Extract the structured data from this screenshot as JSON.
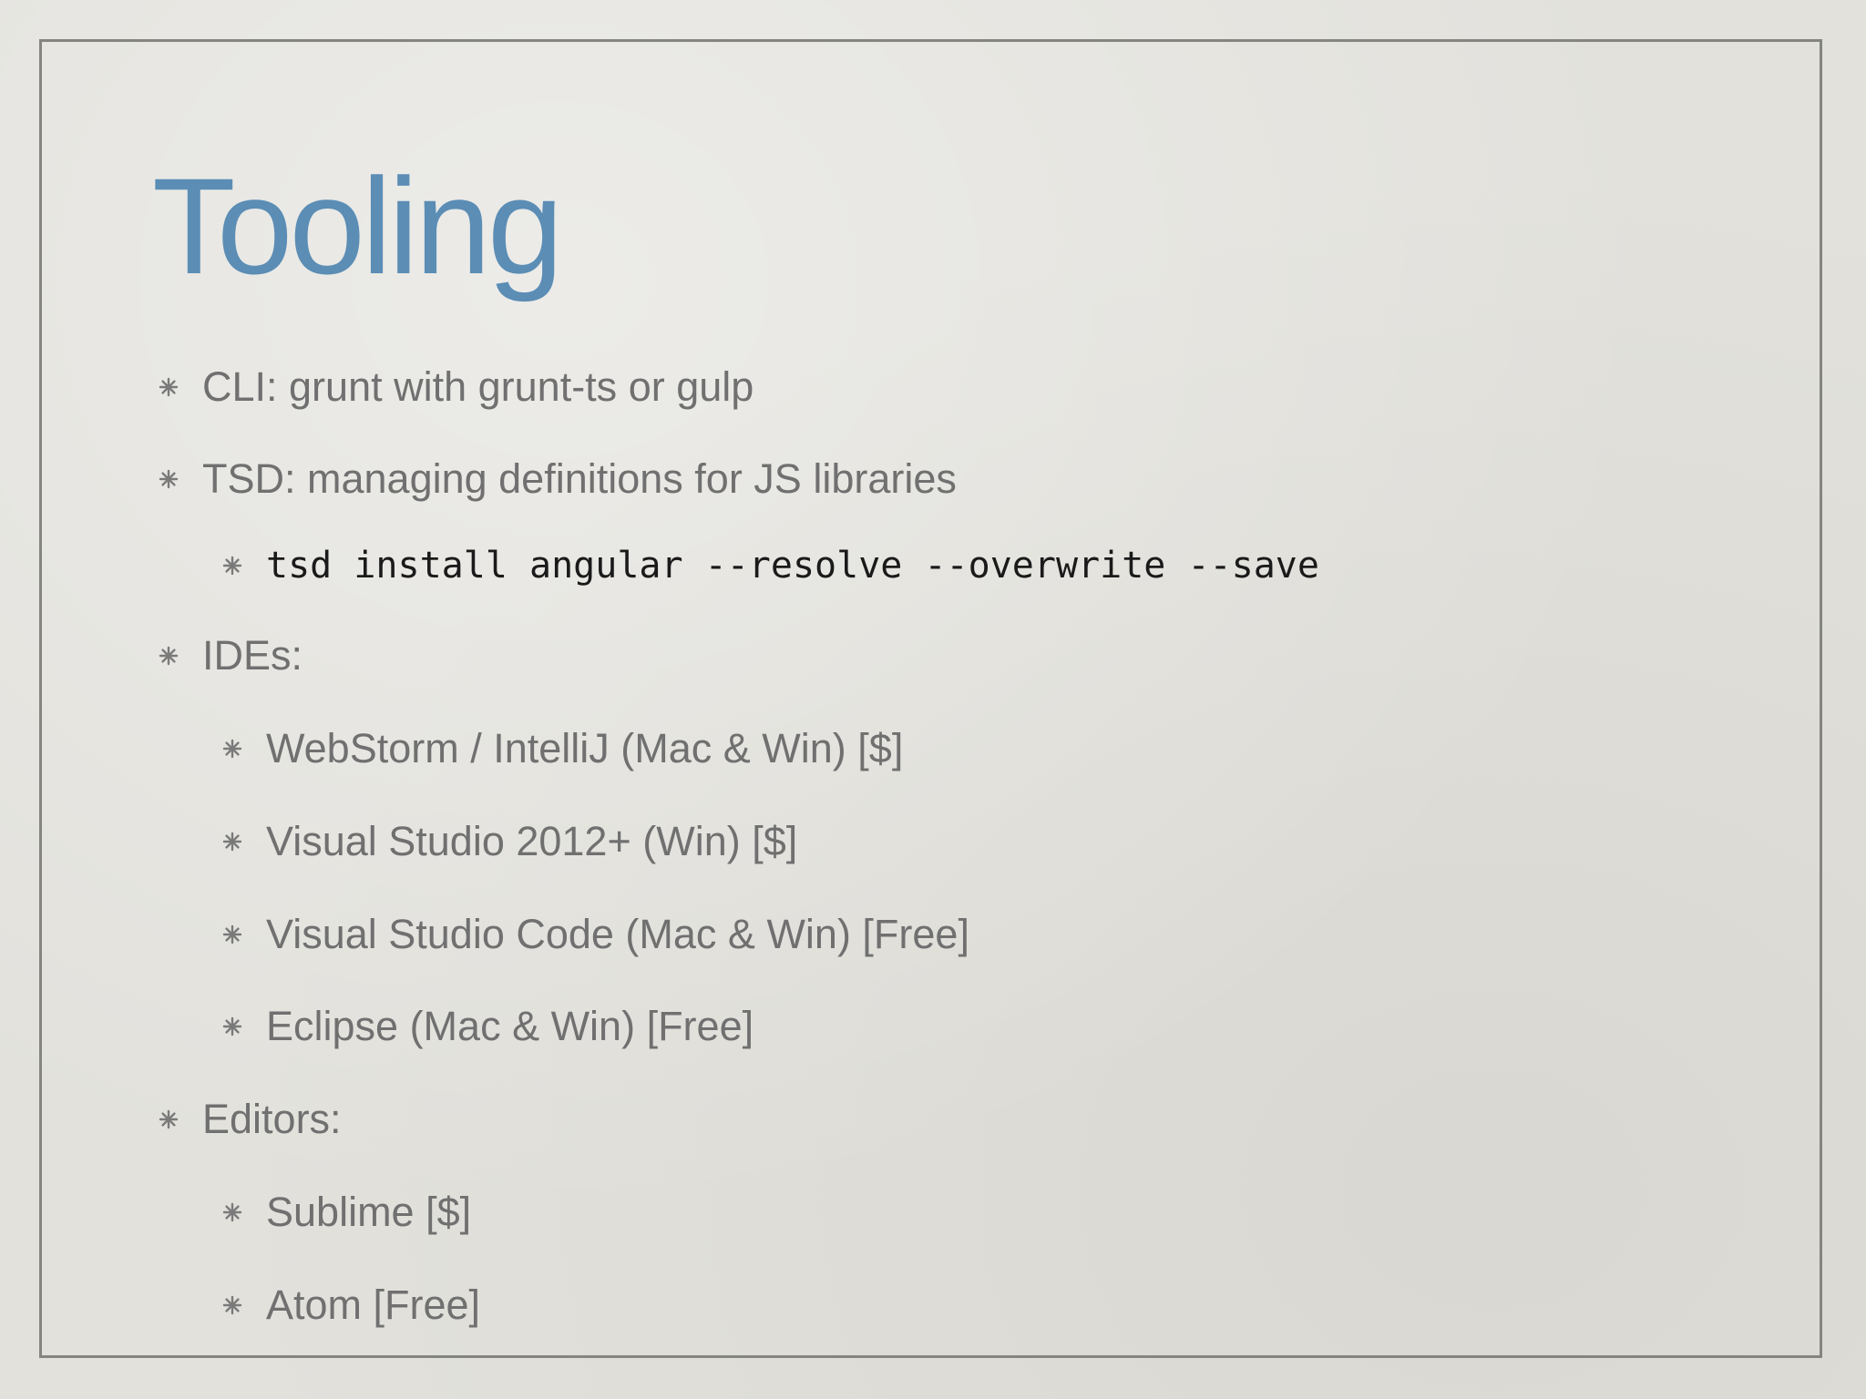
{
  "slide": {
    "title": "Tooling",
    "colors": {
      "title": "#5b8db5",
      "body_text": "#707070",
      "code_text": "#1a1a1a",
      "background": "#e2e1dc",
      "frame": "#858580",
      "bullet": "#7a7a7a"
    },
    "bullet_icon": "asterisk-bullet-icon",
    "items": [
      {
        "level": 1,
        "text": "CLI: grunt with grunt-ts or gulp",
        "style": "normal"
      },
      {
        "level": 1,
        "text": "TSD: managing definitions for JS libraries",
        "style": "normal"
      },
      {
        "level": 2,
        "text": "tsd install angular --resolve --overwrite --save",
        "style": "code"
      },
      {
        "level": 1,
        "text": "IDEs:",
        "style": "normal"
      },
      {
        "level": 2,
        "text": "WebStorm / IntelliJ (Mac & Win) [$]",
        "style": "normal"
      },
      {
        "level": 2,
        "text": "Visual Studio 2012+ (Win) [$]",
        "style": "normal"
      },
      {
        "level": 2,
        "text": "Visual Studio Code (Mac & Win) [Free]",
        "style": "normal"
      },
      {
        "level": 2,
        "text": "Eclipse (Mac & Win) [Free]",
        "style": "normal"
      },
      {
        "level": 1,
        "text": "Editors:",
        "style": "normal"
      },
      {
        "level": 2,
        "text": "Sublime [$]",
        "style": "normal"
      },
      {
        "level": 2,
        "text": "Atom [Free]",
        "style": "normal"
      }
    ]
  }
}
